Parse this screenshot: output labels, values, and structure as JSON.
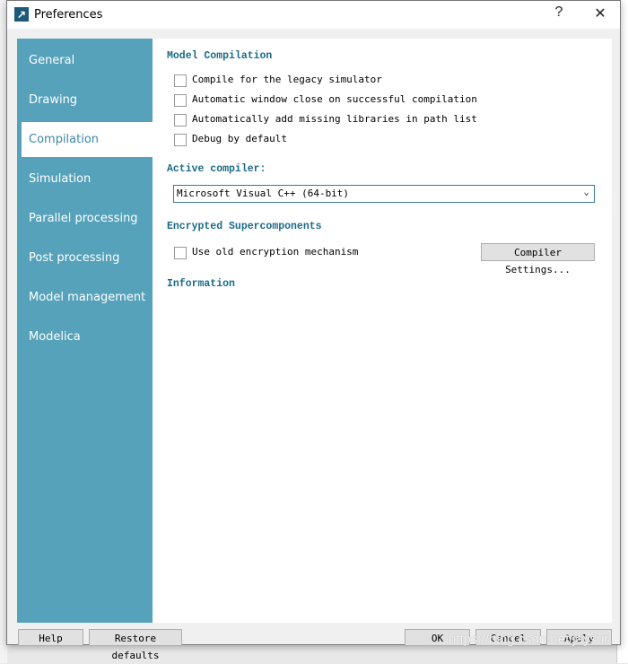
{
  "window": {
    "title": "Preferences",
    "help": "?",
    "close": "✕"
  },
  "sidebar": {
    "items": [
      {
        "label": "General"
      },
      {
        "label": "Drawing"
      },
      {
        "label": "Compilation",
        "selected": true
      },
      {
        "label": "Simulation"
      },
      {
        "label": "Parallel processing"
      },
      {
        "label": "Post processing"
      },
      {
        "label": "Model management"
      },
      {
        "label": "Modelica"
      }
    ]
  },
  "main": {
    "model_compilation": {
      "heading": "Model Compilation",
      "options": [
        {
          "label": "Compile for the legacy simulator",
          "checked": false
        },
        {
          "label": "Automatic window close on successful compilation",
          "checked": false
        },
        {
          "label": "Automatically add missing libraries in path list",
          "checked": false
        },
        {
          "label": "Debug by default",
          "checked": false
        }
      ]
    },
    "active_compiler": {
      "label": "Active compiler:",
      "value": "Microsoft Visual C++ (64-bit)"
    },
    "encrypted": {
      "heading": "Encrypted Supercomponents",
      "option": "Use old encryption mechanism",
      "checked": false,
      "settings_button": "Compiler Settings..."
    },
    "information": {
      "heading": "Information"
    }
  },
  "footer": {
    "help": "Help",
    "restore": "Restore defaults",
    "ok": "OK",
    "cancel": "Cancel",
    "apply": "Apply"
  },
  "watermark": "https://blog.csdn.net/jaysur",
  "colors": {
    "sidebar": "#56a2bb",
    "heading": "#1a6a86"
  }
}
